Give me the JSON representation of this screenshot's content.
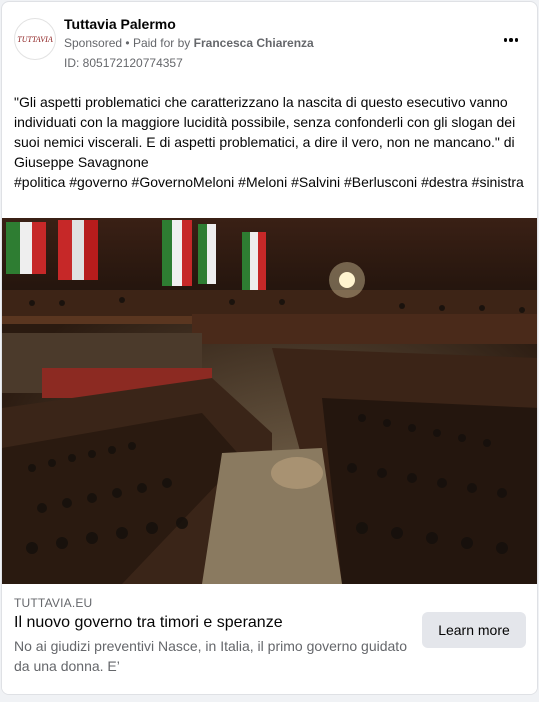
{
  "post": {
    "page_name": "Tuttavia Palermo",
    "sponsored": "Sponsored",
    "separator": "•",
    "paid_for_prefix": "Paid for by",
    "paid_for_name": "Francesca Chiarenza",
    "id_text": "ID: 805172120774357",
    "avatar_logo_text": "TUTTAVIA",
    "more_icon": "more-horizontal-icon",
    "text": "\"Gli aspetti problematici che caratterizzano la nascita di questo esecutivo vanno individuati con la maggiore lucidità possibile, senza confonderli con gli slogan dei suoi nemici viscerali. E di aspetti problematici, a dire il vero, non ne mancano.\" di Giuseppe Savagnone",
    "hashtags": [
      "#politica",
      "#governo",
      "#GovernoMeloni",
      "#Meloni",
      "#Salvini",
      "#Berlusconi",
      "#destra",
      "#sinistra"
    ]
  },
  "link_preview": {
    "domain": "TUTTAVIA.EU",
    "title": "Il nuovo governo tra timori e speranze",
    "description": "No ai giudizi preventivi Nasce, in Italia, il primo governo guidato da una donna. E’",
    "cta_label": "Learn more"
  },
  "colors": {
    "primary_text": "#050505",
    "secondary_text": "#65676b",
    "button_bg": "#e4e6eb"
  }
}
